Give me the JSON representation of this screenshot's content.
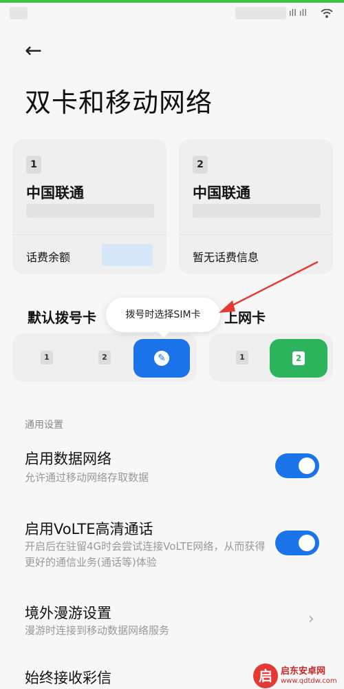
{
  "status": {
    "signal": "ıll ıll",
    "wifi": "wifi-icon"
  },
  "header": {
    "back_icon": "←",
    "title": "双卡和移动网络"
  },
  "sim_cards": [
    {
      "slot": "1",
      "carrier": "中国联通",
      "bottom_label": "话费余额"
    },
    {
      "slot": "2",
      "carrier": "中国联通",
      "bottom_label": "暂无话费信息"
    }
  ],
  "default_dial": {
    "label": "默认拨号卡",
    "options": [
      "1",
      "2",
      "✎"
    ],
    "selected_index": 2,
    "tooltip": "拨号时选择SIM卡"
  },
  "default_data": {
    "label": "上网卡",
    "options": [
      "1",
      "2"
    ],
    "selected_index": 1
  },
  "general": {
    "section_label": "通用设置",
    "items": [
      {
        "title": "启用数据网络",
        "subtitle": "允许通过移动网络存取数据",
        "toggle": true
      },
      {
        "title": "启用VoLTE高清通话",
        "subtitle": "开启后在驻留4G时会尝试连接VoLTE网络，从而获得更好的通信业务(通话等)体验",
        "toggle": true
      },
      {
        "title": "境外漫游设置",
        "subtitle": "漫游时连接到移动数据网络服务",
        "chevron": "›"
      },
      {
        "title": "始终接收彩信"
      }
    ]
  },
  "watermark": {
    "logo": "启",
    "name": "启东安卓网",
    "url": "www.qdtdw.com"
  },
  "colors": {
    "accent": "#1a73e8",
    "data_selected": "#2db55d",
    "arrow": "#e53935"
  }
}
